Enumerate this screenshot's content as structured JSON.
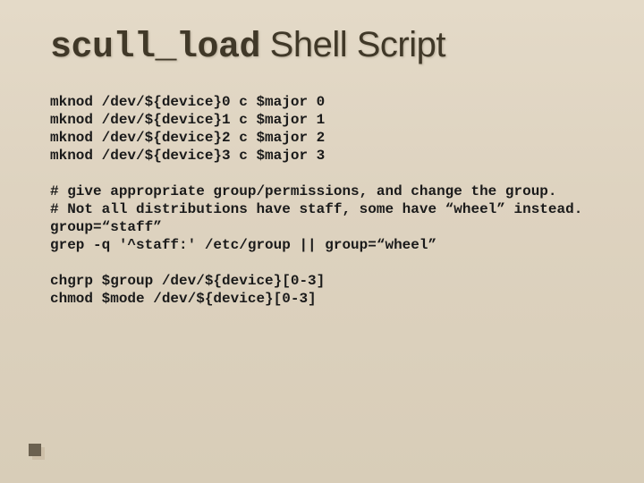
{
  "title": {
    "mono_part": "scull_load",
    "rest": " Shell Script"
  },
  "code": {
    "block1": "mknod /dev/${device}0 c $major 0\nmknod /dev/${device}1 c $major 1\nmknod /dev/${device}2 c $major 2\nmknod /dev/${device}3 c $major 3",
    "block2": "# give appropriate group/permissions, and change the group.\n# Not all distributions have staff, some have “wheel” instead.\ngroup=“staff”\ngrep -q '^staff:' /etc/group || group=“wheel”",
    "block3": "chgrp $group /dev/${device}[0-3]\nchmod $mode /dev/${device}[0-3]"
  }
}
